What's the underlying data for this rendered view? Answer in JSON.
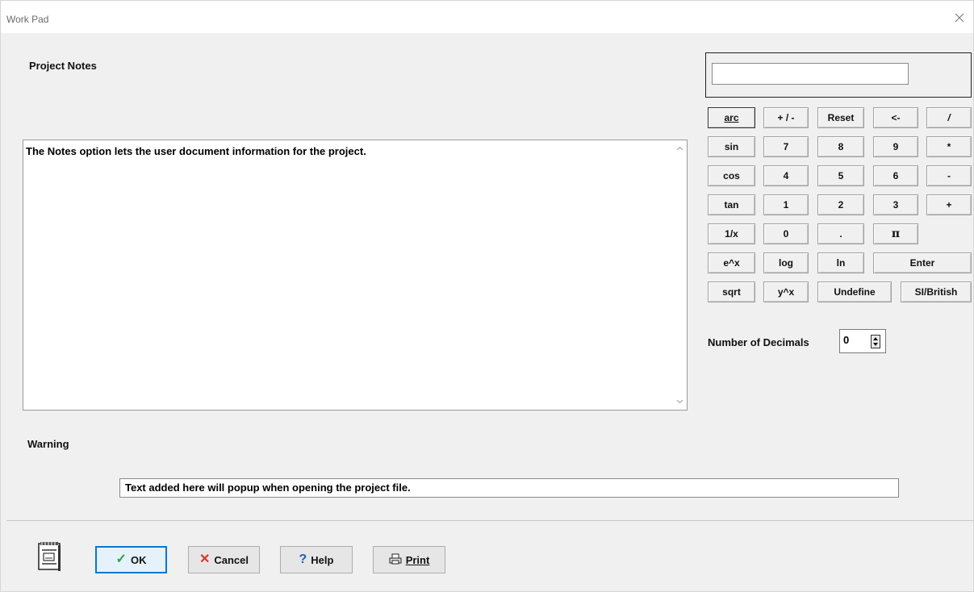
{
  "window": {
    "title": "Work Pad"
  },
  "notes": {
    "label": "Project Notes",
    "text": "The Notes option lets the user document information for the project."
  },
  "calculator": {
    "display_value": "",
    "buttons": {
      "arc": "arc",
      "plus_minus": "+ / -",
      "reset": "Reset",
      "backspace": "<-",
      "divide": "/",
      "sin": "sin",
      "seven": "7",
      "eight": "8",
      "nine": "9",
      "multiply": "*",
      "cos": "cos",
      "four": "4",
      "five": "5",
      "six": "6",
      "minus": "-",
      "tan": "tan",
      "one": "1",
      "two": "2",
      "three": "3",
      "plus": "+",
      "reciprocal": "1/x",
      "zero": "0",
      "decimal": ".",
      "pi": "π",
      "exp": "e^x",
      "log": "log",
      "ln": "ln",
      "enter": "Enter",
      "sqrt": "sqrt",
      "power": "y^x",
      "undefine": "Undefine",
      "units": "SI/British"
    },
    "decimals_label": "Number of Decimals",
    "decimals_value": "0"
  },
  "warning": {
    "label": "Warning",
    "text": "Text added here will popup when opening the project file."
  },
  "footer": {
    "ok": "OK",
    "cancel": "Cancel",
    "help": "Help",
    "print": "Print"
  },
  "colors": {
    "accent": "#0078d7",
    "ok_check": "#2f9e44",
    "cancel_x": "#d9362b",
    "help_q": "#1f5fbf"
  }
}
